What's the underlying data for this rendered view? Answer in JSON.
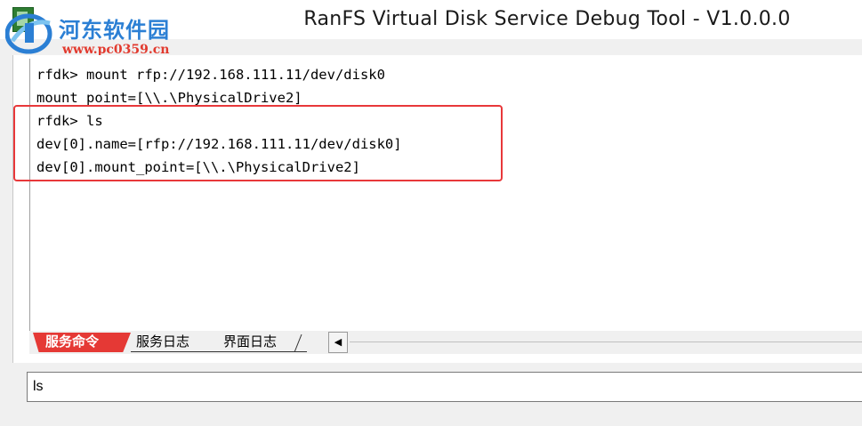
{
  "window": {
    "title": "RanFS Virtual Disk Service Debug Tool - V1.0.0.0"
  },
  "watermark": {
    "name": "河东软件园",
    "url": "www.pc0359.cn"
  },
  "console": {
    "lines": [
      "rfdk> mount rfp://192.168.111.11/dev/disk0",
      "mount point=[\\\\.\\PhysicalDrive2]",
      "rfdk> ls",
      "dev[0].name=[rfp://192.168.111.11/dev/disk0]",
      "dev[0].mount_point=[\\\\.\\PhysicalDrive2]"
    ]
  },
  "tabs": [
    {
      "label": "服务命令",
      "active": true
    },
    {
      "label": "服务日志",
      "active": false
    },
    {
      "label": "界面日志",
      "active": false
    }
  ],
  "command_input": {
    "value": "ls"
  },
  "colors": {
    "active_tab": "#e53935",
    "highlight_box": "#e8383a",
    "watermark_blue": "#2b7fd4",
    "watermark_red": "#e23a2e"
  }
}
